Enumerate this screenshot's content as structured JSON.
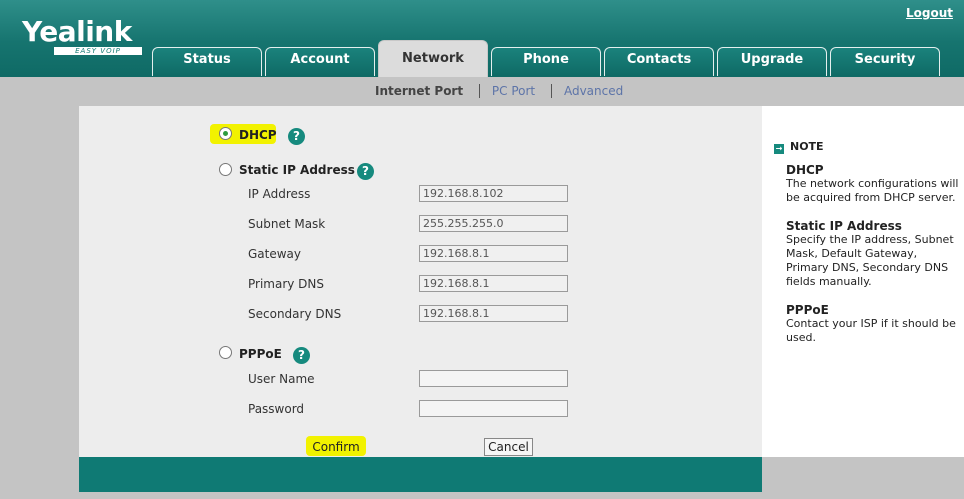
{
  "brand": {
    "logo": "Yealink",
    "tagline": "EASY VOIP"
  },
  "header": {
    "logout": "Logout"
  },
  "tabs": [
    "Status",
    "Account",
    "Network",
    "Phone",
    "Contacts",
    "Upgrade",
    "Security"
  ],
  "active_tab": "Network",
  "subnav": [
    "Internet Port",
    "PC Port",
    "Advanced"
  ],
  "form": {
    "dhcp": {
      "label": "DHCP",
      "selected": true
    },
    "static": {
      "label": "Static IP Address",
      "fields": [
        {
          "label": "IP Address",
          "value": "192.168.8.102"
        },
        {
          "label": "Subnet Mask",
          "value": "255.255.255.0"
        },
        {
          "label": "Gateway",
          "value": "192.168.8.1"
        },
        {
          "label": "Primary DNS",
          "value": "192.168.8.1"
        },
        {
          "label": "Secondary DNS",
          "value": "192.168.8.1"
        }
      ]
    },
    "pppoe": {
      "label": "PPPoE",
      "fields": [
        {
          "label": "User Name",
          "value": ""
        },
        {
          "label": "Password",
          "value": ""
        }
      ]
    },
    "help_glyph": "?",
    "confirm": "Confirm",
    "cancel": "Cancel"
  },
  "note": {
    "heading": "NOTE",
    "items": [
      {
        "title": "DHCP",
        "text": "The network configurations will be acquired from DHCP server."
      },
      {
        "title": "Static IP Address",
        "text": "Specify the IP address, Subnet Mask, Default Gateway, Primary DNS, Secondary DNS fields manually."
      },
      {
        "title": "PPPoE",
        "text": "Contact your ISP if it should be used."
      }
    ]
  },
  "colors": {
    "brand_teal": "#0f7a74",
    "highlight": "#f2f200",
    "gray": "#c4c4c4"
  }
}
